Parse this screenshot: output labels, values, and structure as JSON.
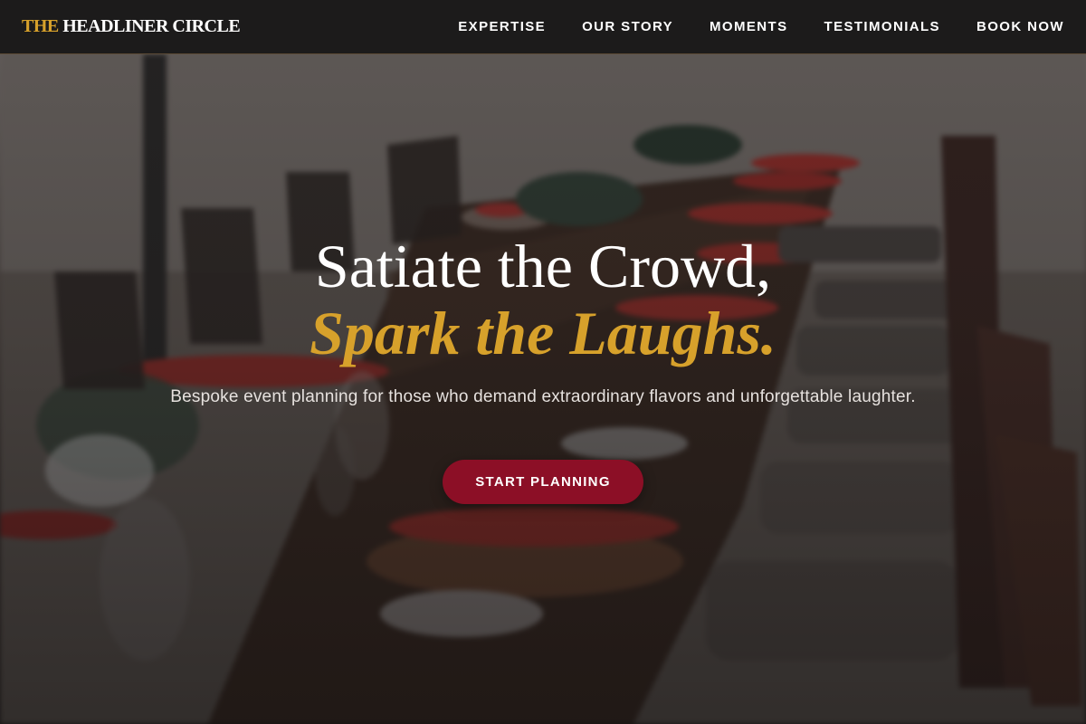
{
  "nav": {
    "brand_accent": "THE",
    "brand_name": "HEADLINER CIRCLE",
    "links": [
      {
        "label": "EXPERTISE"
      },
      {
        "label": "OUR STORY"
      },
      {
        "label": "MOMENTS"
      },
      {
        "label": "TESTIMONIALS"
      },
      {
        "label": "BOOK NOW"
      }
    ]
  },
  "hero": {
    "headline_line1": "Satiate the Crowd,",
    "headline_line2": "Spark the Laughs.",
    "subtitle": "Bespoke event planning for those who demand extraordinary flavors and unforgettable laughter.",
    "cta_label": "START PLANNING",
    "background_image": "banquet-table-photo"
  },
  "colors": {
    "accent_gold": "#d7a12b",
    "cta_red": "#8c0f26",
    "nav_bg": "#1c1b1b"
  }
}
